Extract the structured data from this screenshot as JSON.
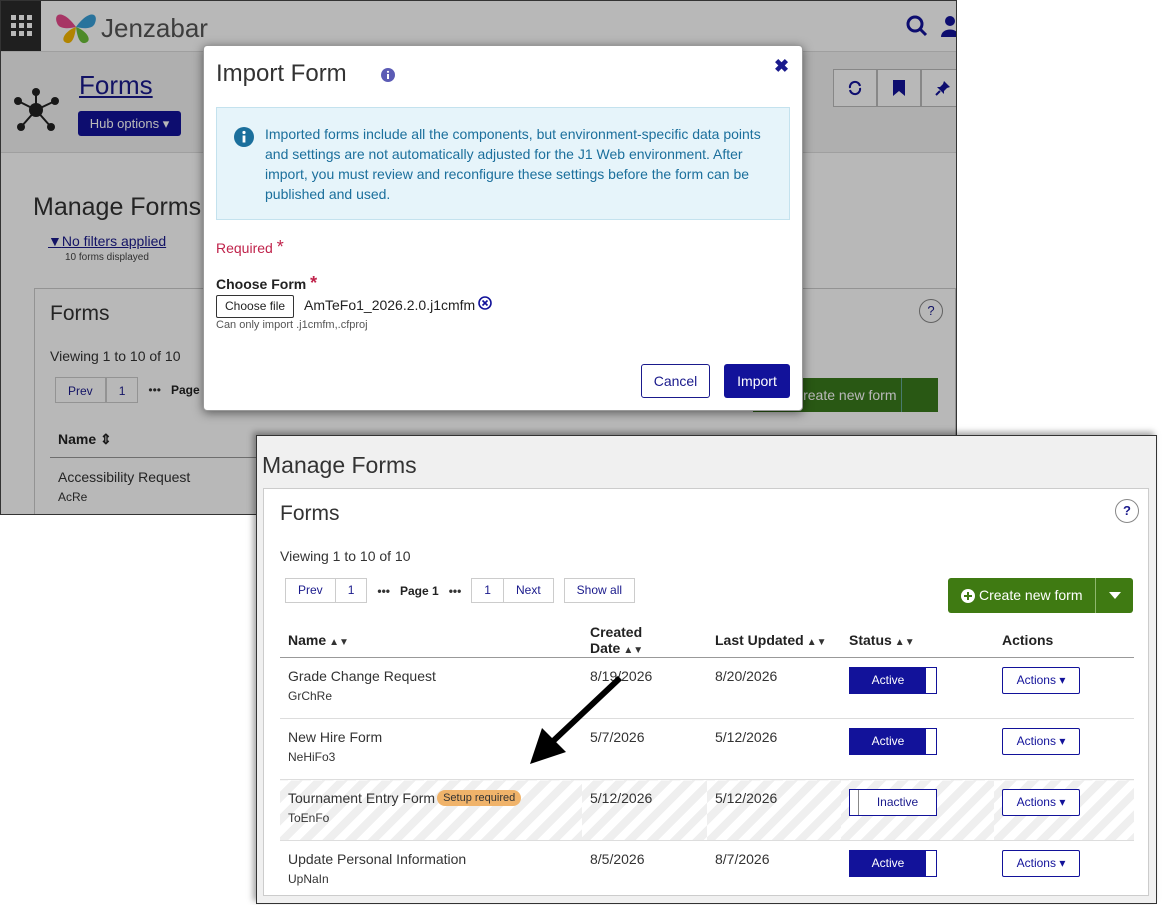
{
  "background": {
    "brand": "Jenzabar",
    "hub_title": "Forms",
    "hub_options_label": "Hub options",
    "manage_forms_title": "Manage Forms",
    "filter_link": "No filters applied",
    "forms_displayed": "10 forms displayed",
    "panel_title": "Forms",
    "viewing": "Viewing 1 to 10 of 10",
    "prev_label": "Prev",
    "page_num": "1",
    "page_label": "Page",
    "create_label": "Create new form",
    "col_name": "Name",
    "row1_name": "Accessibility Request",
    "row1_short": "AcRe",
    "help": "?"
  },
  "modal": {
    "title": "Import Form",
    "info_text": "Imported forms include all the components, but environment-specific data points and settings are not automatically adjusted for the J1 Web environment. After import, you must review and reconfigure these settings before the form can be published and used.",
    "required_label": "Required",
    "choose_label": "Choose Form",
    "choose_button": "Choose file",
    "file_name": "AmTeFo1_2026.2.0.j1cmfm",
    "hint": "Can only import .j1cmfm,.cfproj",
    "cancel": "Cancel",
    "import": "Import",
    "star": "*",
    "close": "✖"
  },
  "foreground": {
    "manage_forms_title": "Manage Forms",
    "panel_title": "Forms",
    "help": "?",
    "viewing": "Viewing 1 to 10 of 10",
    "pagination": {
      "prev": "Prev",
      "first": "1",
      "page_label": "Page 1",
      "last": "1",
      "next": "Next",
      "show_all": "Show all"
    },
    "create_label": "Create new form",
    "columns": [
      "Name",
      "Created Date",
      "Last Updated",
      "Status",
      "Actions"
    ],
    "rows": [
      {
        "name": "Grade Change Request",
        "short": "GrChRe",
        "created": "8/19/2026",
        "updated": "8/20/2026",
        "status": "Active",
        "actions": "Actions"
      },
      {
        "name": "New Hire Form",
        "short": "NeHiFo3",
        "created": "5/7/2026",
        "updated": "5/12/2026",
        "status": "Active",
        "actions": "Actions"
      },
      {
        "name": "Tournament Entry Form",
        "short": "ToEnFo",
        "badge": "Setup required",
        "created": "5/12/2026",
        "updated": "5/12/2026",
        "status": "Inactive",
        "actions": "Actions"
      },
      {
        "name": "Update Personal Information",
        "short": "UpNaIn",
        "created": "8/5/2026",
        "updated": "8/7/2026",
        "status": "Active",
        "actions": "Actions"
      }
    ]
  },
  "colors": {
    "brand_blue": "#12129a",
    "create_green": "#3f7a12",
    "badge_orange": "#f0b36a",
    "info_text": "#1b6f9c",
    "required_red": "#c0234b"
  }
}
